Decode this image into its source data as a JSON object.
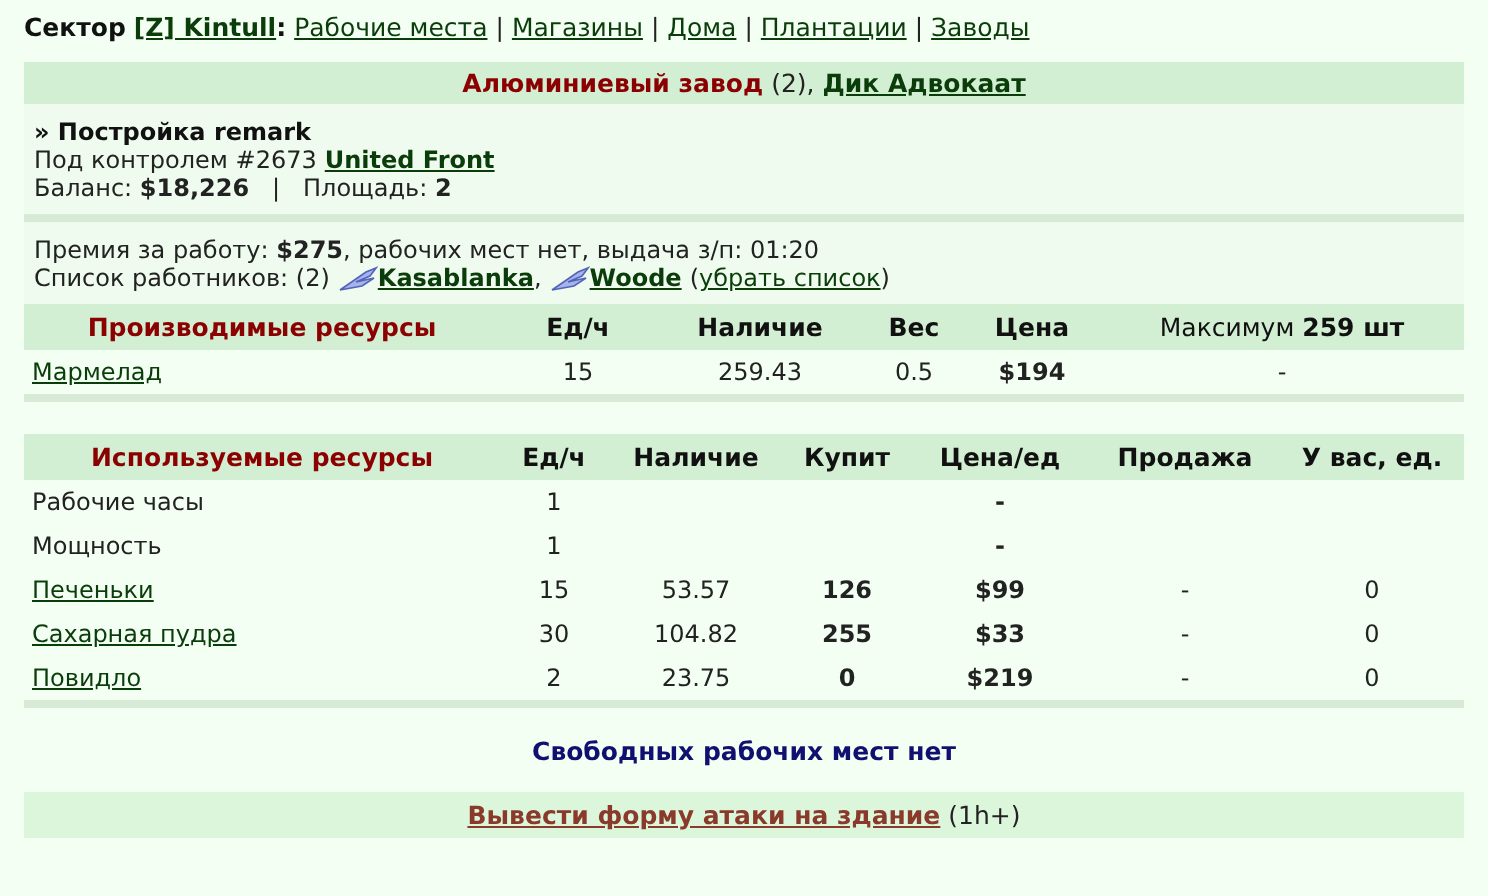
{
  "nav": {
    "sector_label": "Сектор",
    "sector_link": "[Z] Kintull",
    "sector_suffix": ":",
    "links": [
      {
        "label": "Рабочие места"
      },
      {
        "label": "Магазины"
      },
      {
        "label": "Дома"
      },
      {
        "label": "Плантации"
      },
      {
        "label": "Заводы"
      }
    ],
    "separator": "|"
  },
  "header": {
    "title": "Алюминиевый завод",
    "count": "(2),",
    "owner": "Дик Адвокаат"
  },
  "info": {
    "name": "» Постройка remark",
    "control_label": "Под контролем #2673",
    "control_link": "United Front",
    "balance": "Баланс: **$18,226**   |   Площадь: **2**"
  },
  "work": {
    "premium": "Премия за работу: **$275**, рабочих мест нет, выдача з/п: 01:20",
    "workers_label": "Список работников: (2)",
    "workers": [
      {
        "name": "Kasablanka",
        "after": ","
      },
      {
        "name": "Woode"
      }
    ],
    "remove_open": "(",
    "remove_link": "убрать список",
    "remove_close": ")"
  },
  "produced": {
    "columns": [
      {
        "label": "Производимые ресурсы",
        "kind": "title"
      },
      {
        "label": "Ед/ч",
        "kind": "head"
      },
      {
        "label": "Наличие",
        "kind": "head"
      },
      {
        "label": "Вес",
        "kind": "head"
      },
      {
        "label": "Цена",
        "kind": "head",
        "bold_values": true
      },
      {
        "label": "Максимум **259 шт**",
        "kind": "rich"
      }
    ],
    "rows": [
      {
        "kind": "link",
        "cells": [
          "Мармелад",
          "15",
          "259.43",
          "0.5",
          "$194",
          "-"
        ]
      }
    ]
  },
  "used": {
    "columns": [
      {
        "label": "Используемые ресурсы",
        "kind": "title"
      },
      {
        "label": "Ед/ч",
        "kind": "head"
      },
      {
        "label": "Наличие",
        "kind": "head"
      },
      {
        "label": "Купит",
        "kind": "head",
        "bold_values": true
      },
      {
        "label": "Цена/ед",
        "kind": "head",
        "bold_values": true
      },
      {
        "label": "Продажа",
        "kind": "head"
      },
      {
        "label": "У вас, ед.",
        "kind": "head"
      }
    ],
    "rows": [
      {
        "kind": "plain",
        "cells": [
          "Рабочие часы",
          "1",
          "",
          "",
          "-",
          "",
          ""
        ]
      },
      {
        "kind": "plain",
        "cells": [
          "Мощность",
          "1",
          "",
          "",
          "-",
          "",
          ""
        ]
      },
      {
        "kind": "link",
        "cells": [
          "Печеньки",
          "15",
          "53.57",
          "126",
          "$99",
          "-",
          "0"
        ]
      },
      {
        "kind": "link",
        "cells": [
          "Сахарная пудра",
          "30",
          "104.82",
          "255",
          "$33",
          "-",
          "0"
        ]
      },
      {
        "kind": "link",
        "cells": [
          "Повидло",
          "2",
          "23.75",
          "0",
          "$219",
          "-",
          "0"
        ]
      }
    ]
  },
  "free_places": "Свободных рабочих мест нет",
  "attack": {
    "link": "Вывести форму атаки на здание",
    "suffix": "(1h+)"
  }
}
